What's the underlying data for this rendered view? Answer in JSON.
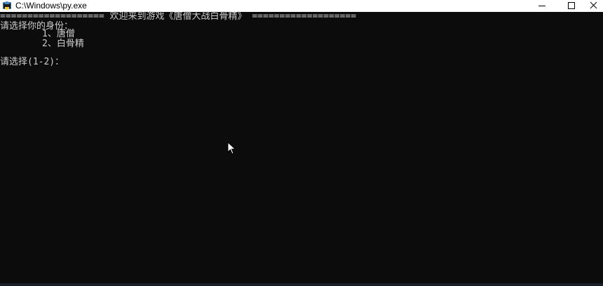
{
  "window": {
    "title": "C:\\Windows\\py.exe"
  },
  "icons": {
    "app": "python-console-icon",
    "minimize": "minimize-icon",
    "maximize": "maximize-icon",
    "close": "close-icon",
    "cursor": "mouse-pointer-icon"
  },
  "console": {
    "lines": [
      "=================== 欢迎来到游戏《唐僧大战白骨精》 ===================",
      "请选择你的身份：",
      "1、唐僧",
      "2、白骨精",
      "请选择(1-2)："
    ]
  },
  "colors": {
    "console_background": "#0c0c0c",
    "console_text": "#cccccc",
    "titlebar_background": "#ffffff"
  }
}
